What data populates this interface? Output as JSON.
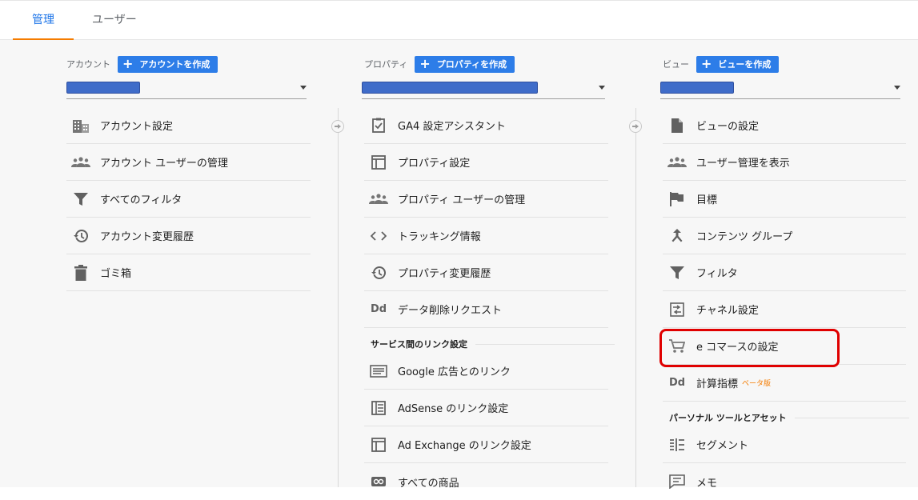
{
  "tabs": {
    "admin": "管理",
    "user": "ユーザー"
  },
  "account": {
    "label": "アカウント",
    "create": "アカウントを作成",
    "items": [
      "アカウント設定",
      "アカウント ユーザーの管理",
      "すべてのフィルタ",
      "アカウント変更履歴",
      "ゴミ箱"
    ]
  },
  "property": {
    "label": "プロパティ",
    "create": "プロパティを作成",
    "items": [
      "GA4 設定アシスタント",
      "プロパティ設定",
      "プロパティ ユーザーの管理",
      "トラッキング情報",
      "プロパティ変更履歴",
      "データ削除リクエスト"
    ],
    "section": "サービス間のリンク設定",
    "links": [
      "Google 広告とのリンク",
      "AdSense のリンク設定",
      "Ad Exchange のリンク設定",
      "すべての商品"
    ]
  },
  "view": {
    "label": "ビュー",
    "create": "ビューを作成",
    "items": [
      "ビューの設定",
      "ユーザー管理を表示",
      "目標",
      "コンテンツ グループ",
      "フィルタ",
      "チャネル設定",
      "e コマースの設定",
      "計算指標"
    ],
    "beta": "ベータ版",
    "section": "パーソナル ツールとアセット",
    "tools": [
      "セグメント",
      "メモ"
    ]
  },
  "colors": {
    "accent": "#1a73e8",
    "tab_underline": "#f57c00",
    "button": "#2d7de8",
    "highlight": "#e00000"
  }
}
